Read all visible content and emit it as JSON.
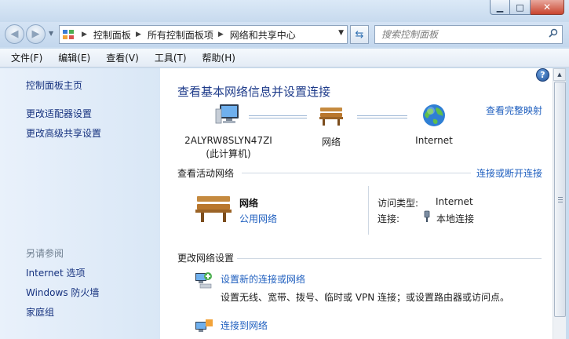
{
  "window": {
    "controls": {
      "minimize": "▁",
      "maximize": "□",
      "close": "✕"
    }
  },
  "address_bar": {
    "breadcrumbs": [
      "控制面板",
      "所有控制面板项",
      "网络和共享中心"
    ],
    "separator": "▶"
  },
  "search": {
    "placeholder": "搜索控制面板"
  },
  "menu": [
    "文件(F)",
    "编辑(E)",
    "查看(V)",
    "工具(T)",
    "帮助(H)"
  ],
  "sidebar": {
    "links": [
      "控制面板主页",
      "更改适配器设置",
      "更改高级共享设置"
    ],
    "see_also_heading": "另请参阅",
    "see_also": [
      "Internet 选项",
      "Windows 防火墙",
      "家庭组"
    ]
  },
  "main": {
    "title": "查看基本网络信息并设置连接",
    "full_map_link": "查看完整映射",
    "map": {
      "computer": {
        "line1": "2ALYRW8SLYN47ZI",
        "line2": "(此计算机)"
      },
      "network": "网络",
      "internet": "Internet"
    },
    "active_networks": {
      "heading": "查看活动网络",
      "connect_link": "连接或断开连接",
      "network_name": "网络",
      "network_type": "公用网络",
      "access_type_label": "访问类型:",
      "access_type_value": "Internet",
      "connection_label": "连接:",
      "connection_value": "本地连接"
    },
    "change_settings": {
      "heading": "更改网络设置",
      "tasks": [
        {
          "title": "设置新的连接或网络",
          "description": "设置无线、宽带、拨号、临时或 VPN 连接；或设置路由器或访问点。"
        },
        {
          "title": "连接到网络"
        }
      ]
    }
  },
  "colors": {
    "link": "#1f5fbf",
    "title": "#1e3b8a",
    "sidebar_link": "#15317e",
    "close_button": "#c9452f"
  }
}
